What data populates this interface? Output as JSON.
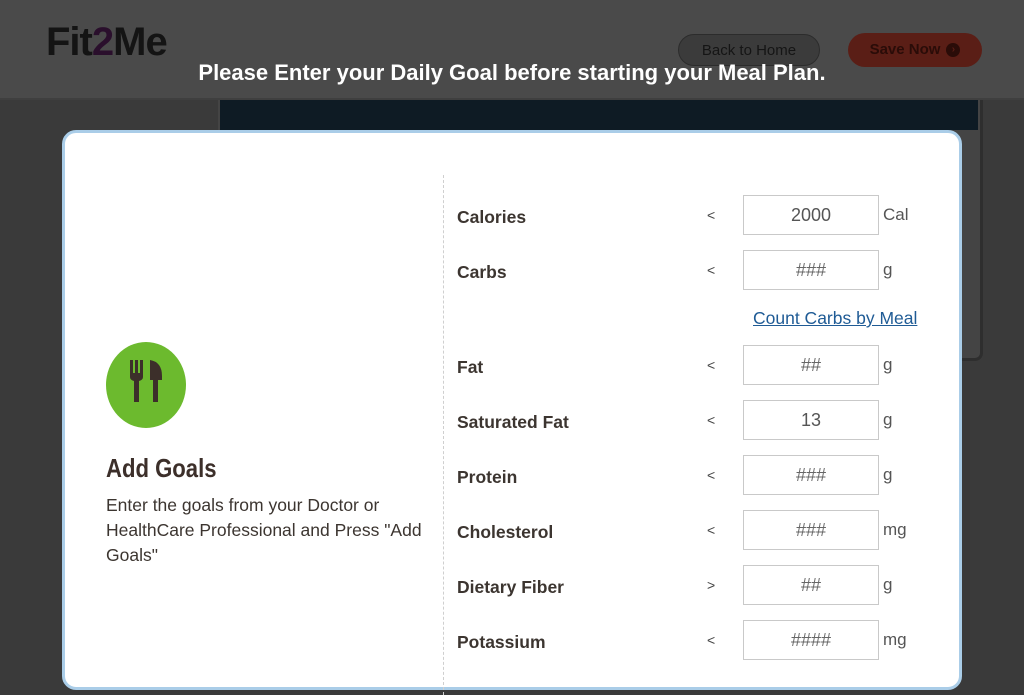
{
  "header": {
    "logo_part1": "Fit",
    "logo_part2": "2",
    "logo_part3": "Me",
    "back_label": "Back to Home",
    "save_label": "Save Now"
  },
  "overlay": {
    "title": "Please Enter your Daily Goal before starting your Meal Plan."
  },
  "left": {
    "heading": "Add Goals",
    "description": "Enter the goals from your Doctor or HealthCare Professional and Press \"Add Goals\""
  },
  "carb_link": "Count Carbs by Meal",
  "goals": [
    {
      "label": "Calories",
      "op": "<",
      "value": "2000",
      "placeholder": "####",
      "unit": "Cal"
    },
    {
      "label": "Carbs",
      "op": "<",
      "value": "",
      "placeholder": "###",
      "unit": "g"
    },
    {
      "label": "Fat",
      "op": "<",
      "value": "",
      "placeholder": "##",
      "unit": "g"
    },
    {
      "label": "Saturated Fat",
      "op": "<",
      "value": "13",
      "placeholder": "##",
      "unit": "g"
    },
    {
      "label": "Protein",
      "op": "<",
      "value": "",
      "placeholder": "###",
      "unit": "g"
    },
    {
      "label": "Cholesterol",
      "op": "<",
      "value": "",
      "placeholder": "###",
      "unit": "mg"
    },
    {
      "label": "Dietary Fiber",
      "op": ">",
      "value": "",
      "placeholder": "##",
      "unit": "g"
    },
    {
      "label": "Potassium",
      "op": "<",
      "value": "",
      "placeholder": "####",
      "unit": "mg"
    }
  ],
  "colors": {
    "accent_green": "#6cba2e",
    "link_blue": "#1f5b95",
    "modal_border": "#aacde8"
  },
  "icons": {
    "goal_icon": "fork-knife-icon",
    "save_arrow": "arrow-right-circle-icon"
  }
}
